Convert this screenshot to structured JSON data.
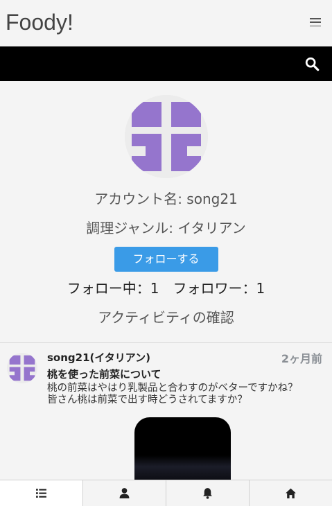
{
  "header": {
    "brand": "Foody!",
    "menu_icon": "hamburger-icon",
    "search_icon": "search-icon"
  },
  "profile": {
    "account_label": "アカウント名: song21",
    "genre_label": "調理ジャンル: イタリアン",
    "follow_button": "フォローする",
    "following": "フォロー中：1",
    "followers": "フォロワー：1",
    "activity_link": "アクティビティの確認",
    "avatar_color": "#9575cd"
  },
  "post": {
    "author": "song21(イタリアン)",
    "time": "2ヶ月前",
    "title": "桃を使った前菜について",
    "body": "桃の前菜はやはり乳製品と合わすのがベターですかね？\n皆さん桃は前菜で出す時どうされてますか？"
  },
  "nav": {
    "items": [
      {
        "icon": "list-icon",
        "active": true
      },
      {
        "icon": "user-icon",
        "active": false
      },
      {
        "icon": "bell-icon",
        "active": false
      },
      {
        "icon": "home-icon",
        "active": false
      }
    ]
  },
  "colors": {
    "accent": "#3a9be7",
    "avatar": "#9575cd",
    "searchbar": "#000000"
  }
}
